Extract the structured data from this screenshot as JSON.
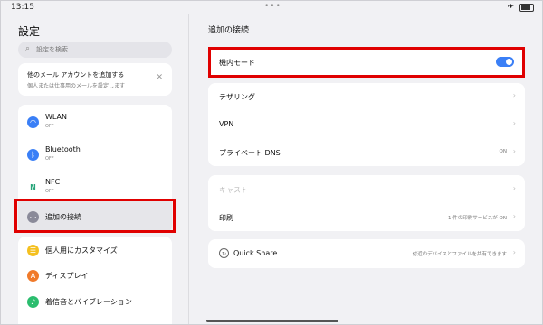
{
  "status": {
    "time": "13:15",
    "dots": "•••"
  },
  "sidebar": {
    "title": "設定",
    "search_placeholder": "設定を検索",
    "promo": {
      "title": "他のメール アカウントを追加する",
      "subtitle": "個人または仕事用のメールを設定します"
    },
    "group1": [
      {
        "label": "WLAN",
        "sub": "OFF",
        "icon": "wifi-icon",
        "color": "#3a7ff6"
      },
      {
        "label": "Bluetooth",
        "sub": "OFF",
        "icon": "bluetooth-icon",
        "color": "#3a7ff6"
      },
      {
        "label": "NFC",
        "sub": "OFF",
        "icon": "nfc-icon",
        "color": "#27a57a"
      },
      {
        "label": "追加の接続",
        "icon": "more-connections-icon",
        "color": "#8a8a99"
      }
    ],
    "group2": [
      {
        "label": "個人用にカスタマイズ",
        "icon": "customize-icon",
        "color": "#f4c020"
      },
      {
        "label": "ディスプレイ",
        "icon": "display-icon",
        "color": "#f07a2a"
      },
      {
        "label": "着信音とバイブレーション",
        "icon": "sound-icon",
        "color": "#2bbd6e"
      }
    ]
  },
  "main": {
    "title": "追加の接続",
    "airplane": {
      "label": "機内モード",
      "on": true
    },
    "rows": [
      {
        "label": "テザリング"
      },
      {
        "label": "VPN"
      },
      {
        "label": "プライベート DNS",
        "value": "ON"
      }
    ],
    "rows2": [
      {
        "label": "キャスト",
        "disabled": true
      },
      {
        "label": "印刷",
        "value": "1 件の印刷サービスが ON"
      }
    ],
    "quickshare": {
      "label": "Quick Share",
      "value": "付近のデバイスとファイルを共有できます"
    }
  },
  "colors": {
    "accent": "#3a7ff6",
    "highlight": "#e00000"
  }
}
